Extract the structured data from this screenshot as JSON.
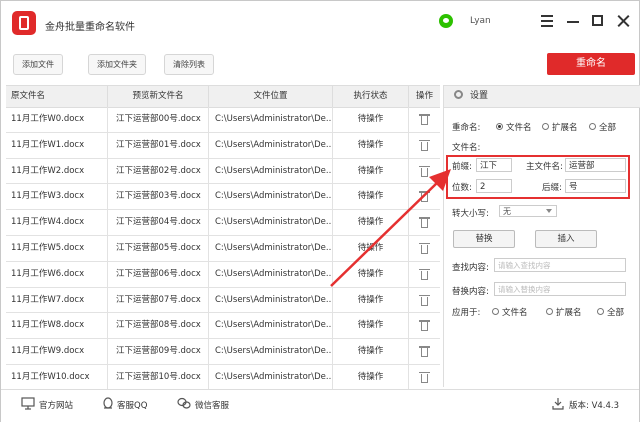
{
  "app": {
    "title": "金舟批量重命名软件",
    "user": "Lyan",
    "accent": "#e02a2a"
  },
  "toolbar": {
    "add_file": "添加文件",
    "add_folder": "添加文件夹",
    "clear_list": "清除列表",
    "rename": "重命名"
  },
  "table": {
    "headers": [
      "原文件名",
      "预览新文件名",
      "文件位置",
      "执行状态",
      "操作"
    ],
    "rows": [
      {
        "original": "11月工作W0.docx",
        "preview": "江下运营部00号.docx",
        "location": "C:\\Users\\Administrator\\De...",
        "status": "待操作"
      },
      {
        "original": "11月工作W1.docx",
        "preview": "江下运营部01号.docx",
        "location": "C:\\Users\\Administrator\\De...",
        "status": "待操作"
      },
      {
        "original": "11月工作W2.docx",
        "preview": "江下运营部02号.docx",
        "location": "C:\\Users\\Administrator\\De...",
        "status": "待操作"
      },
      {
        "original": "11月工作W3.docx",
        "preview": "江下运营部03号.docx",
        "location": "C:\\Users\\Administrator\\De...",
        "status": "待操作"
      },
      {
        "original": "11月工作W4.docx",
        "preview": "江下运营部04号.docx",
        "location": "C:\\Users\\Administrator\\De...",
        "status": "待操作"
      },
      {
        "original": "11月工作W5.docx",
        "preview": "江下运营部05号.docx",
        "location": "C:\\Users\\Administrator\\De...",
        "status": "待操作"
      },
      {
        "original": "11月工作W6.docx",
        "preview": "江下运营部06号.docx",
        "location": "C:\\Users\\Administrator\\De...",
        "status": "待操作"
      },
      {
        "original": "11月工作W7.docx",
        "preview": "江下运营部07号.docx",
        "location": "C:\\Users\\Administrator\\De...",
        "status": "待操作"
      },
      {
        "original": "11月工作W8.docx",
        "preview": "江下运营部08号.docx",
        "location": "C:\\Users\\Administrator\\De...",
        "status": "待操作"
      },
      {
        "original": "11月工作W9.docx",
        "preview": "江下运营部09号.docx",
        "location": "C:\\Users\\Administrator\\De...",
        "status": "待操作"
      },
      {
        "original": "11月工作W10.docx",
        "preview": "江下运营部10号.docx",
        "location": "C:\\Users\\Administrator\\De...",
        "status": "待操作"
      }
    ]
  },
  "settings": {
    "header": "设置",
    "rename_label": "重命名:",
    "rename_options": [
      "文件名",
      "扩展名",
      "全部"
    ],
    "rename_selected": "文件名",
    "filename_label": "文件名:",
    "prefix_label": "前缀:",
    "prefix_value": "江下",
    "main_name_label": "主文件名:",
    "main_name_value": "运营部",
    "digits_label": "位数:",
    "digits_value": "2",
    "suffix_label": "后缀:",
    "suffix_value": "号",
    "case_label": "转大小写:",
    "case_value": "无",
    "replace_button": "替换",
    "insert_button": "插入",
    "find_label": "查找内容:",
    "find_placeholder": "请输入查找内容",
    "replace_label": "替换内容:",
    "replace_placeholder": "请输入替换内容",
    "apply_label": "应用于:",
    "apply_options": [
      "文件名",
      "扩展名",
      "全部"
    ]
  },
  "footer": {
    "website": "官方网站",
    "qq": "客服QQ",
    "wechat": "微信客服",
    "version": "版本: V4.4.3"
  }
}
